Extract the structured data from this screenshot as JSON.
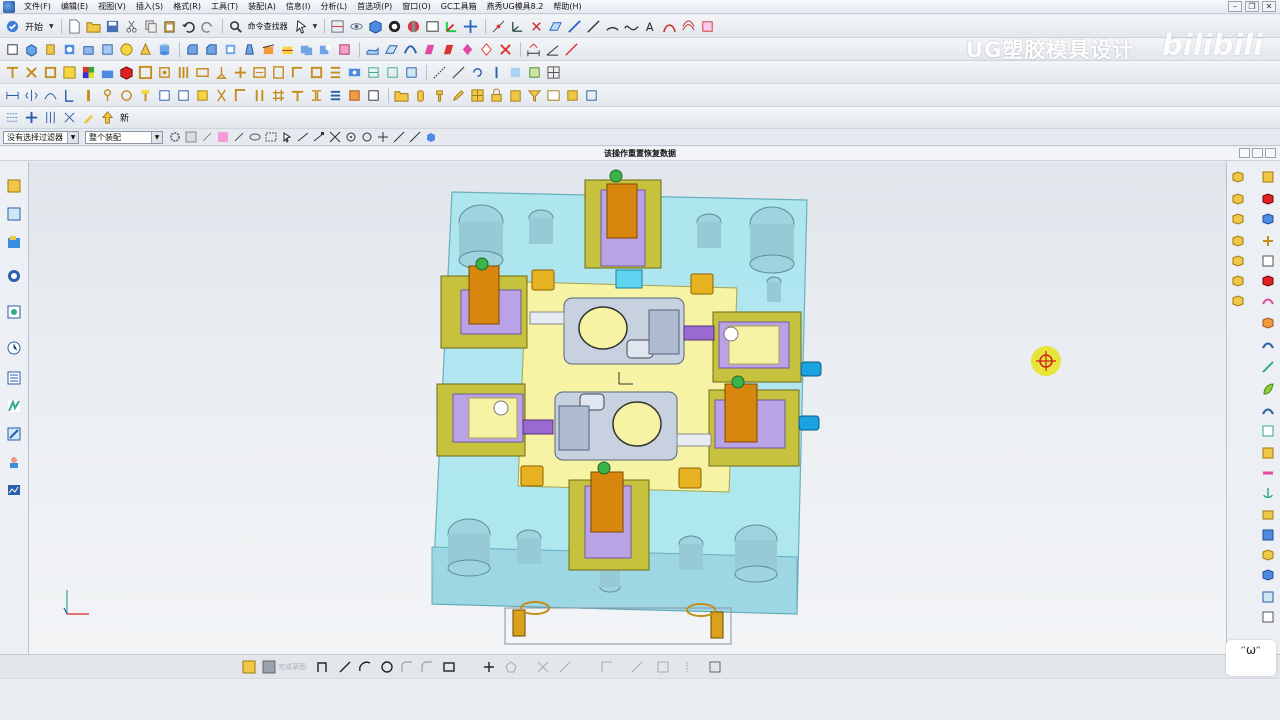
{
  "menu": {
    "items": [
      "文件(F)",
      "编辑(E)",
      "视图(V)",
      "插入(S)",
      "格式(R)",
      "工具(T)",
      "装配(A)",
      "信息(I)",
      "分析(L)",
      "首选项(P)",
      "窗口(O)",
      "GC工具箱",
      "燕秀UG模具8.2",
      "帮助(H)"
    ]
  },
  "toolbar": {
    "start_label": "开始",
    "command_finder_label": "命令查找器",
    "new_label": "新"
  },
  "filter": {
    "selection_filter": "没有选择过滤器",
    "assembly_scope": "整个装配"
  },
  "status": {
    "message": "该操作重置恢复数据"
  },
  "snap": {
    "sketch_label": "完成草图"
  },
  "watermark": {
    "text": "UG塑胶模具设计",
    "brand": "bilibili"
  },
  "colors": {
    "plate": "#a9e6ef",
    "core": "#f7f3a5",
    "slider": "#c7c23e",
    "purple": "#b9a3e6",
    "orange": "#d9860f",
    "gold": "#e7b323",
    "part": "#c7d1df"
  },
  "badge": {
    "text": "ᵔωᵔ"
  }
}
